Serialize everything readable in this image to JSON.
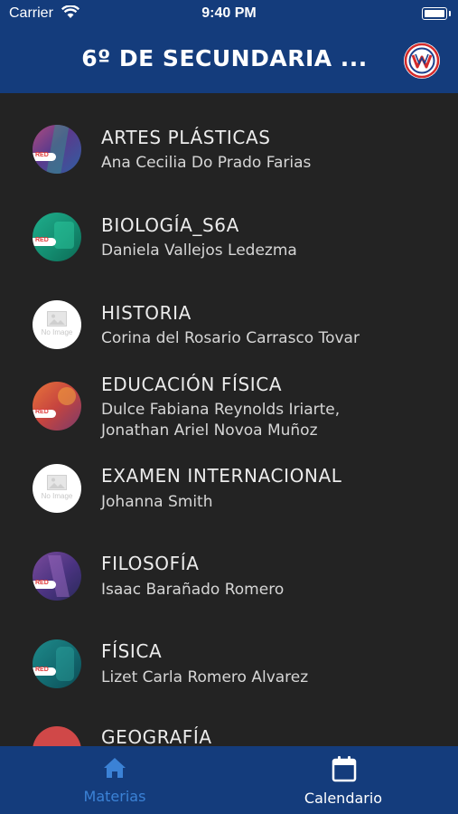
{
  "status_bar": {
    "carrier": "Carrier",
    "time": "9:40 PM"
  },
  "header": {
    "title": "6º DE SECUNDARIA ..."
  },
  "courses": [
    {
      "name": "ARTES PLÁSTICAS",
      "teacher": "Ana Cecilia Do Prado Farias",
      "image": "purple"
    },
    {
      "name": "BIOLOGÍA_S6A",
      "teacher": "Daniela Vallejos Ledezma",
      "image": "green"
    },
    {
      "name": "HISTORIA",
      "teacher": "Corina del Rosario Carrasco Tovar",
      "image": "none"
    },
    {
      "name": "EDUCACIÓN FÍSICA",
      "teacher": "Dulce Fabiana Reynolds Iriarte,",
      "teacher2": "Jonathan Ariel Novoa Muñoz",
      "image": "orange"
    },
    {
      "name": "EXAMEN INTERNACIONAL",
      "teacher": "Johanna Smith",
      "image": "none"
    },
    {
      "name": "FILOSOFÍA",
      "teacher": "Isaac Barañado Romero",
      "image": "purple"
    },
    {
      "name": "FÍSICA",
      "teacher": "Lizet Carla Romero Alvarez",
      "image": "teal"
    },
    {
      "name": "GEOGRAFÍA",
      "teacher": "",
      "image": "red"
    }
  ],
  "avatar_placeholder": {
    "text": "No Image"
  },
  "avatar_badge": {
    "text": "RED"
  },
  "tabbar": {
    "materias": "Materias",
    "calendario": "Calendario",
    "active_color": "#3b82d6",
    "inactive_color": "#ffffff"
  }
}
